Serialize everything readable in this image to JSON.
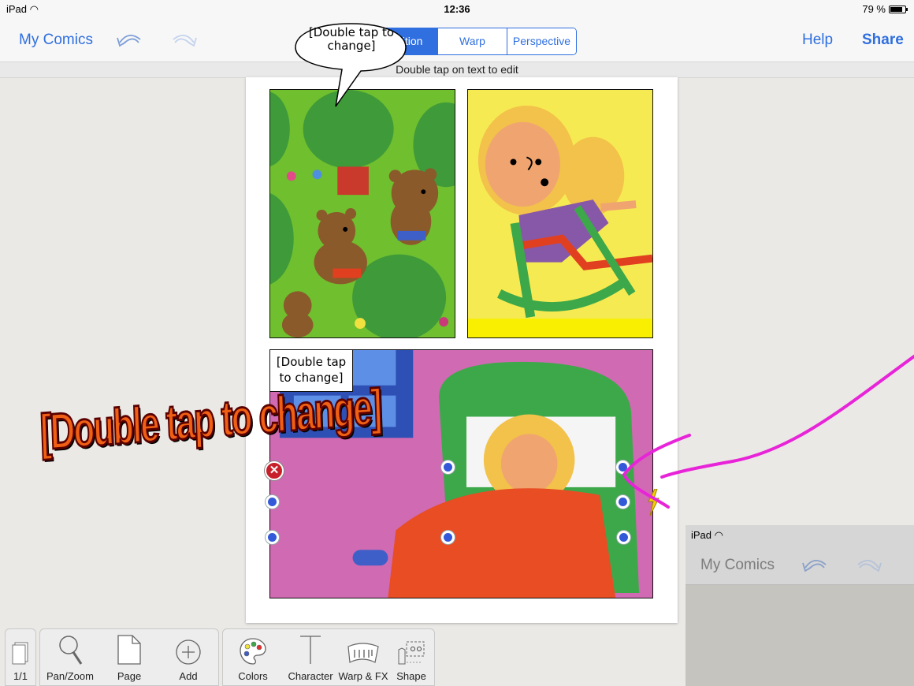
{
  "status_bar": {
    "device": "iPad",
    "time": "12:36",
    "battery": "79 %"
  },
  "nav": {
    "back_label": "My Comics",
    "undo_icon": "undo-icon",
    "redo_icon": "redo-icon",
    "segments": [
      "Position",
      "Warp",
      "Perspective"
    ],
    "active_segment": "Position",
    "help_label": "Help",
    "share_label": "Share"
  },
  "hint": "Double tap on text to edit",
  "comic": {
    "speech_bubble_text": "[Double tap to change]",
    "caption_text": "[Double tap to change]",
    "fx_text": "[Double tap to change]"
  },
  "toolbar": {
    "page_indicator": "1/1",
    "tools": [
      {
        "label": "Pan/Zoom",
        "icon": "magnifier-icon"
      },
      {
        "label": "Page",
        "icon": "page-icon"
      },
      {
        "label": "Add",
        "icon": "plus-circle-icon"
      },
      {
        "label": "Colors",
        "icon": "palette-icon"
      },
      {
        "label": "Character",
        "icon": "text-cursor-icon"
      },
      {
        "label": "Warp & FX",
        "icon": "warp-fx-icon"
      },
      {
        "label": "Shape",
        "icon": "scissors-shape-icon"
      }
    ]
  },
  "overlay": {
    "device": "iPad",
    "title": "My Comics"
  },
  "colors": {
    "accent": "#2f6fe0",
    "annotation": "#e824d8",
    "handle": "#3359d9",
    "delete": "#c8202a"
  }
}
